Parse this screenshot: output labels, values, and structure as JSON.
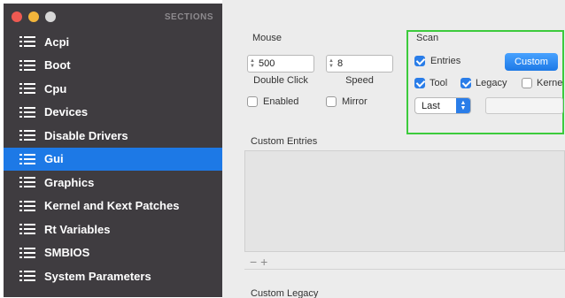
{
  "sidebar": {
    "header": "SECTIONS",
    "items": [
      {
        "label": "Acpi",
        "selected": false
      },
      {
        "label": "Boot",
        "selected": false
      },
      {
        "label": "Cpu",
        "selected": false
      },
      {
        "label": "Devices",
        "selected": false
      },
      {
        "label": "Disable Drivers",
        "selected": false
      },
      {
        "label": "Gui",
        "selected": true
      },
      {
        "label": "Graphics",
        "selected": false
      },
      {
        "label": "Kernel and Kext Patches",
        "selected": false
      },
      {
        "label": "Rt Variables",
        "selected": false
      },
      {
        "label": "SMBIOS",
        "selected": false
      },
      {
        "label": "System Parameters",
        "selected": false
      }
    ]
  },
  "mouse": {
    "title": "Mouse",
    "double_click_value": "500",
    "double_click_label": "Double Click",
    "speed_value": "8",
    "speed_label": "Speed",
    "enabled_label": "Enabled",
    "enabled_checked": false,
    "mirror_label": "Mirror",
    "mirror_checked": false
  },
  "scan": {
    "title": "Scan",
    "entries_label": "Entries",
    "entries_checked": true,
    "custom_button": "Custom",
    "tool_label": "Tool",
    "tool_checked": true,
    "legacy_label": "Legacy",
    "legacy_checked": true,
    "kernel_label": "Kerne",
    "kernel_checked": false,
    "popup_value": "Last",
    "text_field_value": ""
  },
  "custom_entries": {
    "title": "Custom Entries",
    "add_remove": "− +"
  },
  "custom_legacy": {
    "title": "Custom Legacy"
  },
  "colors": {
    "sidebar_bg": "#3f3c40",
    "selection": "#1d79e6",
    "highlight_box": "#3ccb3c"
  }
}
